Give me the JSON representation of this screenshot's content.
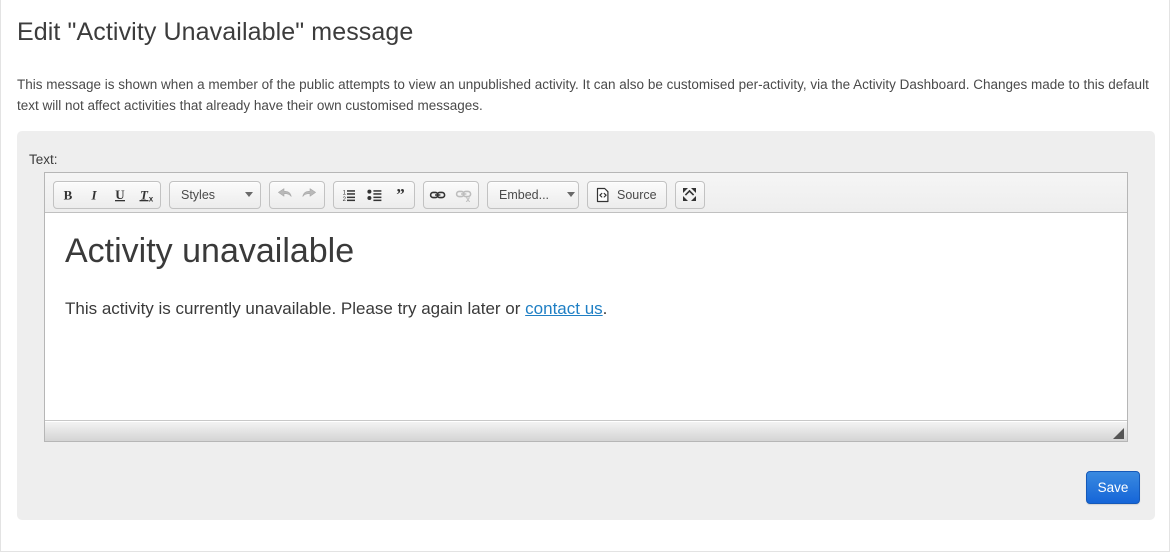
{
  "page": {
    "title": "Edit \"Activity Unavailable\" message",
    "description": "This message is shown when a member of the public attempts to view an unpublished activity. It can also be customised per-activity, via the Activity Dashboard. Changes made to this default text will not affect activities that already have their own customised messages."
  },
  "form": {
    "field_label": "Text:",
    "save_label": "Save"
  },
  "editor": {
    "toolbar": {
      "bold": "B",
      "italic": "I",
      "underline": "U",
      "remove_format": "remove-format-icon",
      "styles_label": "Styles",
      "undo": "undo-icon",
      "redo": "redo-icon",
      "numbered_list": "numbered-list-icon",
      "bulleted_list": "bulleted-list-icon",
      "blockquote": "blockquote-icon",
      "link": "link-icon",
      "unlink": "unlink-icon",
      "embed_label": "Embed...",
      "source_label": "Source",
      "maximize": "maximize-icon"
    },
    "content": {
      "heading": "Activity unavailable",
      "paragraph_before": "This activity is currently unavailable. Please try again later or ",
      "link_text": "contact us",
      "paragraph_after": "."
    }
  },
  "colors": {
    "link": "#1f7fc4",
    "save_button": "#1565d8",
    "panel_background": "#eeeeee"
  }
}
